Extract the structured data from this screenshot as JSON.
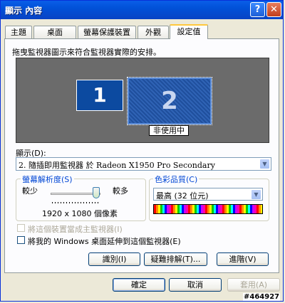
{
  "window": {
    "title": "顯示 內容",
    "help_button": "?",
    "close_button": "✕"
  },
  "tabs": [
    {
      "label": "主題",
      "active": false
    },
    {
      "label": "桌面",
      "active": false
    },
    {
      "label": "螢幕保護裝置",
      "active": false
    },
    {
      "label": "外觀",
      "active": false
    },
    {
      "label": "設定值",
      "active": true
    }
  ],
  "settings": {
    "instruction": "拖曳監視器圖示來符合監視器實際的安排。",
    "monitor1_label": "1",
    "monitor2_label": "2",
    "monitor2_tooltip": "非使用中",
    "display_label": "顯示(D):",
    "display_value": "2. 隨插即用監視器 於 Radeon X1950 Pro Secondary",
    "resolution_group": "螢幕解析度(S)",
    "slider_less": "較少",
    "slider_more": "較多",
    "slider_level": 1.0,
    "resolution_value": "1920 x 1080 個像素",
    "color_group": "色彩品質(C)",
    "color_value": "最高 (32 位元)",
    "primary_checkbox": {
      "label": "將這個裝置當成主監視器(I)",
      "checked": false,
      "enabled": false
    },
    "extend_checkbox": {
      "label": "將我的 Windows 桌面延伸到這個監視器(E)",
      "checked": false,
      "enabled": true
    },
    "identify_button": "識別(I)",
    "troubleshoot_button": "疑難排解(T)...",
    "advanced_button": "進階(V)"
  },
  "footer": {
    "ok_button": "確定",
    "cancel_button": "取消",
    "apply_button": "套用(A)"
  },
  "watermark": "#464927"
}
